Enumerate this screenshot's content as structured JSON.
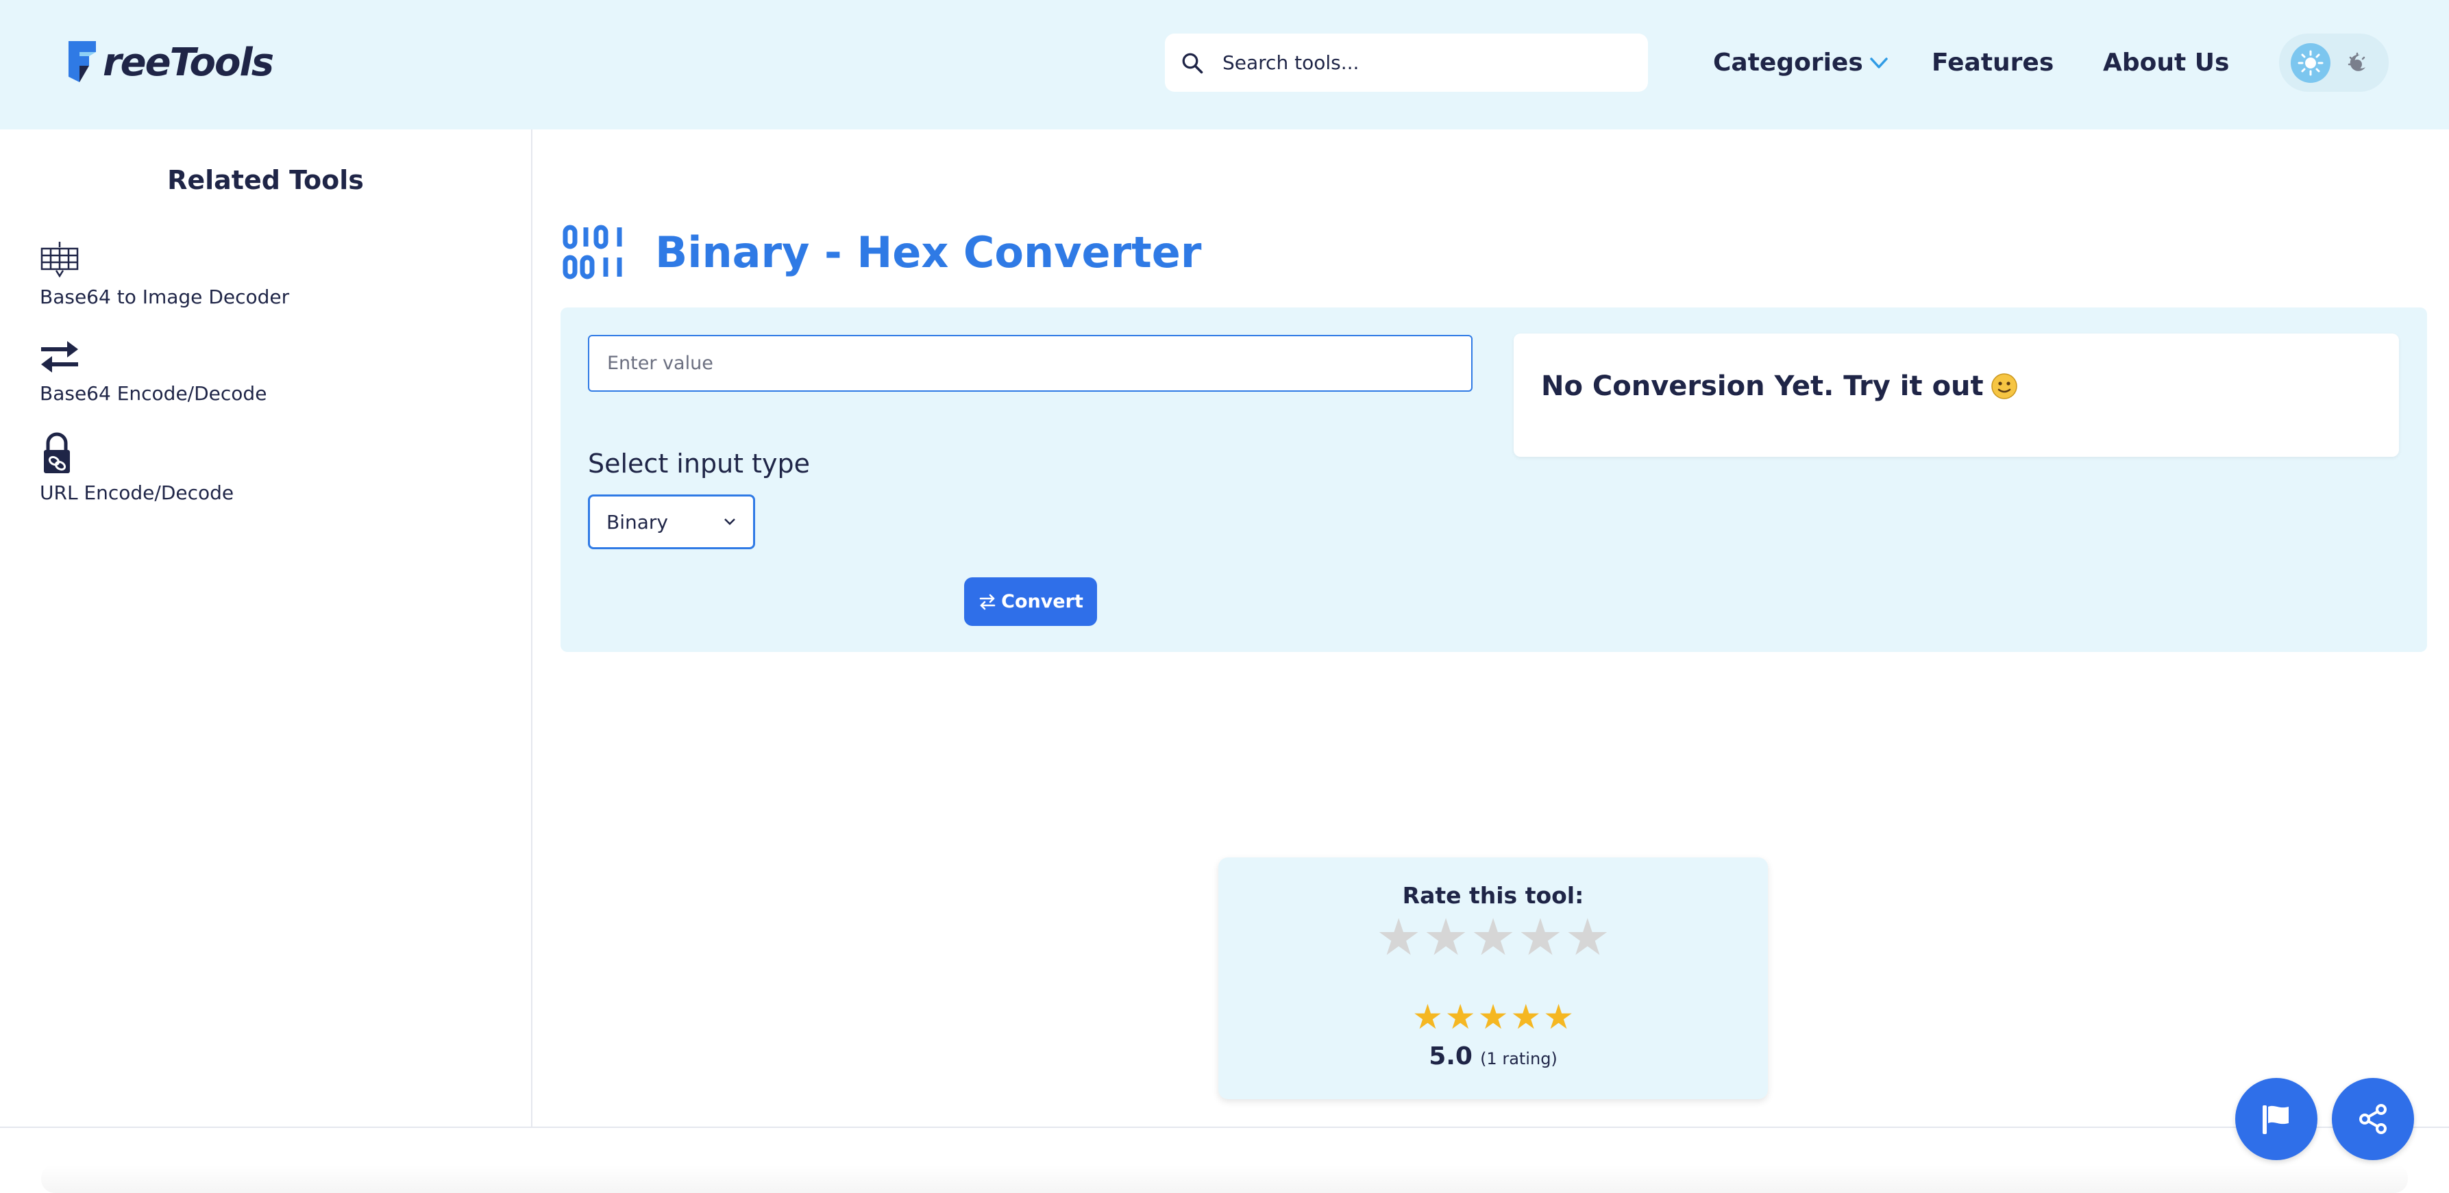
{
  "header": {
    "logo_text": "reeTools",
    "search": {
      "placeholder": "Search tools..."
    },
    "nav": {
      "categories": "Categories",
      "features": "Features",
      "about": "About Us"
    },
    "theme": {
      "light_icon": "sun-icon",
      "dark_icon": "moon-icon",
      "active": "light"
    }
  },
  "sidebar": {
    "title": "Related Tools",
    "items": [
      {
        "label": "Base64 to Image Decoder",
        "icon": "image-grid-icon"
      },
      {
        "label": "Base64 Encode/Decode",
        "icon": "swap-arrows-icon"
      },
      {
        "label": "URL Encode/Decode",
        "icon": "lock-link-icon"
      }
    ]
  },
  "main": {
    "title": "Binary - Hex Converter",
    "icon": "binary-icon",
    "input": {
      "placeholder": "Enter value",
      "value": ""
    },
    "select_label": "Select input type",
    "select_value": "Binary",
    "convert_label": "Convert",
    "result_text": "No Conversion Yet. Try it out"
  },
  "rating": {
    "label": "Rate this tool:",
    "user_rating": 0,
    "average_stars": 5,
    "average": "5.0",
    "count_text": "(1 rating)"
  },
  "fabs": {
    "report_icon": "flag-icon",
    "share_icon": "share-icon"
  },
  "colors": {
    "accent": "#2f7ae5",
    "button": "#2f6fe9",
    "header_bg": "#e6f6fc",
    "text": "#1f2547",
    "star_filled": "#f5b722",
    "star_empty": "#d6d6d6"
  }
}
